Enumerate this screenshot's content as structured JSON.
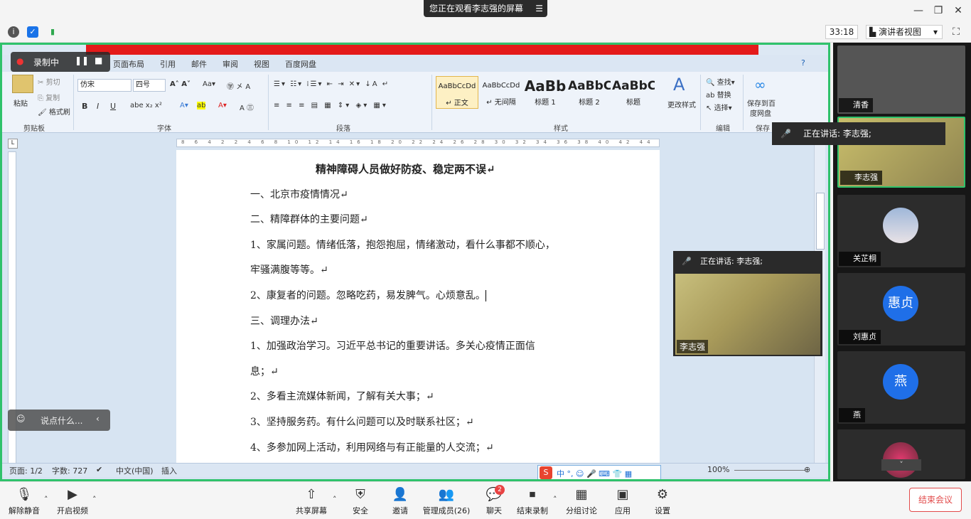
{
  "topbar": {
    "sharing_text": "您正在观看李志强的屏幕",
    "menu_glyph": "☰",
    "minimize": "—",
    "restore": "❐",
    "close": "✕"
  },
  "toolbar2": {
    "timer": "33:18",
    "view_mode": "演讲者视图",
    "view_caret": "▾"
  },
  "word": {
    "tabs": [
      "页面布局",
      "引用",
      "邮件",
      "审阅",
      "视图",
      "百度网盘"
    ],
    "clipboard": {
      "paste": "粘贴",
      "cut": "剪切",
      "copy": "复制",
      "format_painter": "格式刷",
      "group": "剪贴板"
    },
    "font": {
      "name": "仿宋",
      "size": "四号",
      "group": "字体"
    },
    "paragraph": {
      "group": "段落"
    },
    "styles": {
      "group": "样式",
      "items": [
        {
          "sample": "AaBbCcDd",
          "label": "↵ 正文"
        },
        {
          "sample": "AaBbCcDd",
          "label": "↵ 无间隔"
        },
        {
          "sample": "AaBb",
          "label": "标题 1"
        },
        {
          "sample": "AaBbC",
          "label": "标题 2"
        },
        {
          "sample": "AaBbC",
          "label": "标题"
        }
      ],
      "change": "更改样式"
    },
    "editing": {
      "find": "查找",
      "replace": "替换",
      "select": "选择",
      "group": "编辑"
    },
    "save": {
      "label1": "保存到百",
      "label2": "度网盘",
      "group": "保存"
    },
    "ruler_text": "8 6 4 2 2 4 6 8 10 12 14 16 18 20 22 24 26 28 30 32 34 36 38 40 42 44 46 48",
    "document": {
      "title": "精神障碍人员做好防疫、稳定两不误↵",
      "lines": [
        "一、北京市疫情情况↵",
        "二、精障群体的主要问题↵",
        " 1、家属问题。情绪低落，抱怨抱屈，情绪激动，看什么事都不顺心，",
        "牢骚满腹等等。↵",
        " 2、康复者的问题。忽略吃药，易发脾气。心烦意乱。",
        "三、调理办法↵",
        "  1、加强政治学习。习近平总书记的重要讲话。多关心疫情正面信",
        "息；↵",
        "  2、多看主流媒体新闻，了解有关大事；↵",
        "  3、坚持服务药。有什么问题可以及时联系社区；↵",
        "  4、多参加网上活动，利用网络与有正能量的人交流；↵"
      ]
    },
    "status": {
      "page": "页面: 1/2",
      "words": "字数: 727",
      "lang": "中文(中国)",
      "mode": "插入",
      "zoom": "100%"
    }
  },
  "overlay": {
    "recording": "录制中",
    "chat_placeholder": "说点什么...",
    "ime": "中 °, ☺ 🎤 ⌨ 👕 ▦"
  },
  "float_speaker": {
    "speaking": "正在讲话: 李志强;",
    "name": "李志强"
  },
  "participants": [
    {
      "name": "清香",
      "type": "video"
    },
    {
      "name": "李志强",
      "type": "video"
    },
    {
      "name": "关芷桐",
      "type": "photo"
    },
    {
      "name": "刘惠贞",
      "type": "initials",
      "initials": "惠贞"
    },
    {
      "name": "燕",
      "type": "initials",
      "initials": "燕"
    },
    {
      "name": "",
      "type": "photo"
    }
  ],
  "speaking_popup": "正在讲话: 李志强;",
  "bottom": {
    "unmute": "解除静音",
    "start_video": "开启视频",
    "share": "共享屏幕",
    "security": "安全",
    "invite": "邀请",
    "manage": "管理成员(26)",
    "chat": "聊天",
    "chat_badge": "2",
    "stop_record": "结束录制",
    "breakout": "分组讨论",
    "apps": "应用",
    "settings": "设置",
    "end": "结束会议"
  },
  "colors": {
    "accent_green": "#2fc26b",
    "red_banner": "#e41a1a",
    "avatar_blue": "#1f6fe8",
    "end_red": "#e24b4b"
  }
}
